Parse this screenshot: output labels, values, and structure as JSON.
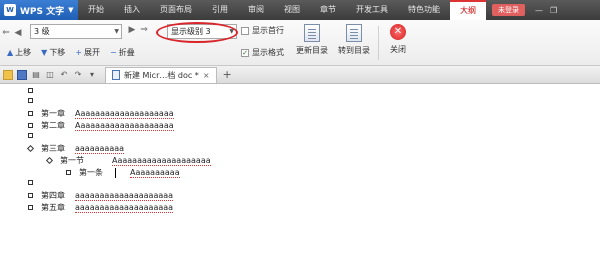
{
  "titlebar": {
    "app_name": "WPS 文字",
    "logo": "W",
    "menu": [
      "开始",
      "插入",
      "页面布局",
      "引用",
      "审阅",
      "视图",
      "章节",
      "开发工具",
      "特色功能",
      "大纲"
    ],
    "active_menu": "大纲",
    "login_label": "未登录"
  },
  "ribbon": {
    "outline_level_value": "3 级",
    "show_level_value": "显示级别 3",
    "move_up": "上移",
    "move_down": "下移",
    "expand": "展开",
    "collapse": "折叠",
    "show_first_line": "显示首行",
    "show_format": "显示格式",
    "update_toc": "更新目录",
    "goto_toc": "转到目录",
    "close": "关闭"
  },
  "tabs": {
    "doc_tab": "新建 Micr…档 doc *"
  },
  "outline": {
    "ch1": "第一章",
    "ch1_text": "Aaaaaaaaaaaaaaaaaaaa",
    "ch2": "第二章",
    "ch2_text": "Aaaaaaaaaaaaaaaaaaaa",
    "ch3": "第三章",
    "ch3_text": "aaaaaaaaaa",
    "sec1": "第一节",
    "sec1_text": "Aaaaaaaaaaaaaaaaaaaa",
    "art1": "第一条",
    "art1_text": "Aaaaaaaaaa",
    "ch4": "第四章",
    "ch4_text": "aaaaaaaaaaaaaaaaaaaa",
    "ch5": "第五章",
    "ch5_text": "aaaaaaaaaaaaaaaaaaaa"
  },
  "colors": {
    "accent": "#d9262b",
    "app_blue": "#1f5fb5"
  }
}
